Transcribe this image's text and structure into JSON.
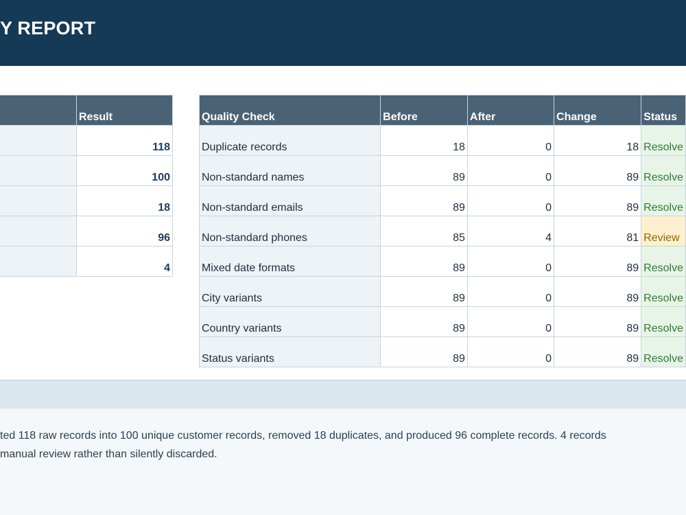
{
  "header": {
    "title": "Y REPORT"
  },
  "left_table": {
    "columns": [
      "",
      "Result"
    ],
    "rows": [
      {
        "label": "",
        "result": "118"
      },
      {
        "label": "",
        "result": "100"
      },
      {
        "label": "",
        "result": "18"
      },
      {
        "label": "",
        "result": "96"
      },
      {
        "label": "",
        "result": "4"
      }
    ]
  },
  "quality_table": {
    "columns": [
      "Quality Check",
      "Before",
      "After",
      "Change",
      "Status"
    ],
    "rows": [
      {
        "check": "Duplicate records",
        "before": "18",
        "after": "0",
        "change": "18",
        "status": "Resolve",
        "status_type": "resolved"
      },
      {
        "check": "Non-standard names",
        "before": "89",
        "after": "0",
        "change": "89",
        "status": "Resolve",
        "status_type": "resolved"
      },
      {
        "check": "Non-standard emails",
        "before": "89",
        "after": "0",
        "change": "89",
        "status": "Resolve",
        "status_type": "resolved"
      },
      {
        "check": "Non-standard phones",
        "before": "85",
        "after": "4",
        "change": "81",
        "status": "Review",
        "status_type": "review"
      },
      {
        "check": "Mixed date formats",
        "before": "89",
        "after": "0",
        "change": "89",
        "status": "Resolve",
        "status_type": "resolved"
      },
      {
        "check": "City variants",
        "before": "89",
        "after": "0",
        "change": "89",
        "status": "Resolve",
        "status_type": "resolved"
      },
      {
        "check": "Country variants",
        "before": "89",
        "after": "0",
        "change": "89",
        "status": "Resolve",
        "status_type": "resolved"
      },
      {
        "check": "Status variants",
        "before": "89",
        "after": "0",
        "change": "89",
        "status": "Resolve",
        "status_type": "resolved"
      }
    ]
  },
  "summary": {
    "line1": "ted 118 raw records into 100 unique customer records, removed 18 duplicates, and produced 96 complete records. 4 records",
    "line2": " manual review rather than silently discarded."
  },
  "colors": {
    "header_bg": "#153a56",
    "table_header_bg": "#4a6275",
    "resolved_bg": "#e8f4e8",
    "resolved_text": "#2e7d32",
    "review_bg": "#fdf0cf",
    "review_text": "#8a6a00"
  }
}
